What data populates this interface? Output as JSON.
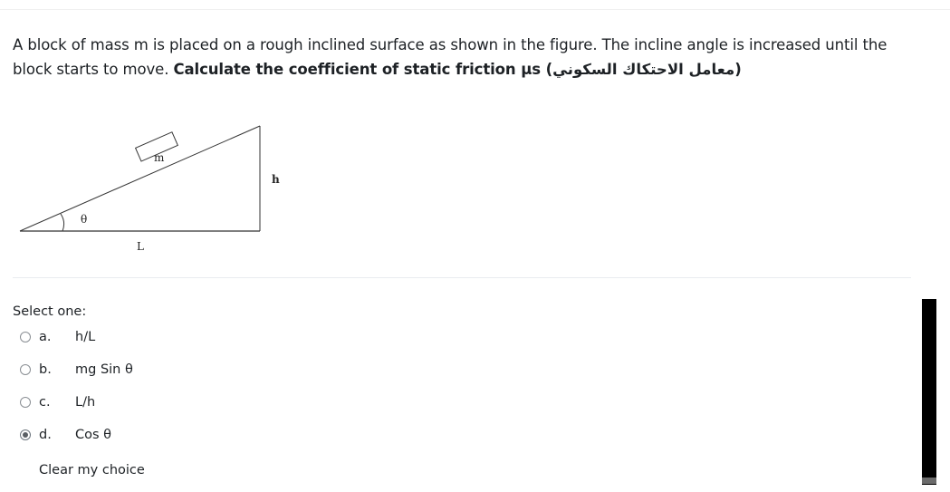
{
  "question": {
    "text_plain": "A block of mass m is placed on a rough inclined surface as shown in the figure. The incline angle is increased until the block starts to move. ",
    "text_bold": "Calculate the coefficient of static friction μs (معامل الاحتكاك السكوني)"
  },
  "figure": {
    "block_label": "m",
    "angle_label": "θ",
    "height_label": "h",
    "base_label": "L"
  },
  "answer": {
    "prompt": "Select one:",
    "options": [
      {
        "letter": "a.",
        "text": "h/L",
        "checked": false
      },
      {
        "letter": "b.",
        "text": "mg Sin θ",
        "checked": false
      },
      {
        "letter": "c.",
        "text": "L/h",
        "checked": false
      },
      {
        "letter": "d.",
        "text": "Cos θ",
        "checked": true
      }
    ],
    "clear_label": "Clear my choice"
  }
}
